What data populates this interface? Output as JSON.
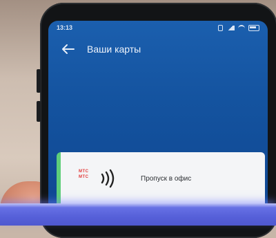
{
  "status_bar": {
    "time": "13:13"
  },
  "app_bar": {
    "back_icon": "arrow-left-icon",
    "title": "Ваши карты"
  },
  "card": {
    "logo_text_top": "МТС",
    "logo_text_bottom": "МТС",
    "nfc_icon": "nfc-contactless-icon",
    "label": "Пропуск в офис",
    "accent_color": "#5fce7a"
  },
  "colors": {
    "screen_primary": "#14539f",
    "bottom_bar": "#5660d9",
    "logo_red": "#e23a3a"
  }
}
